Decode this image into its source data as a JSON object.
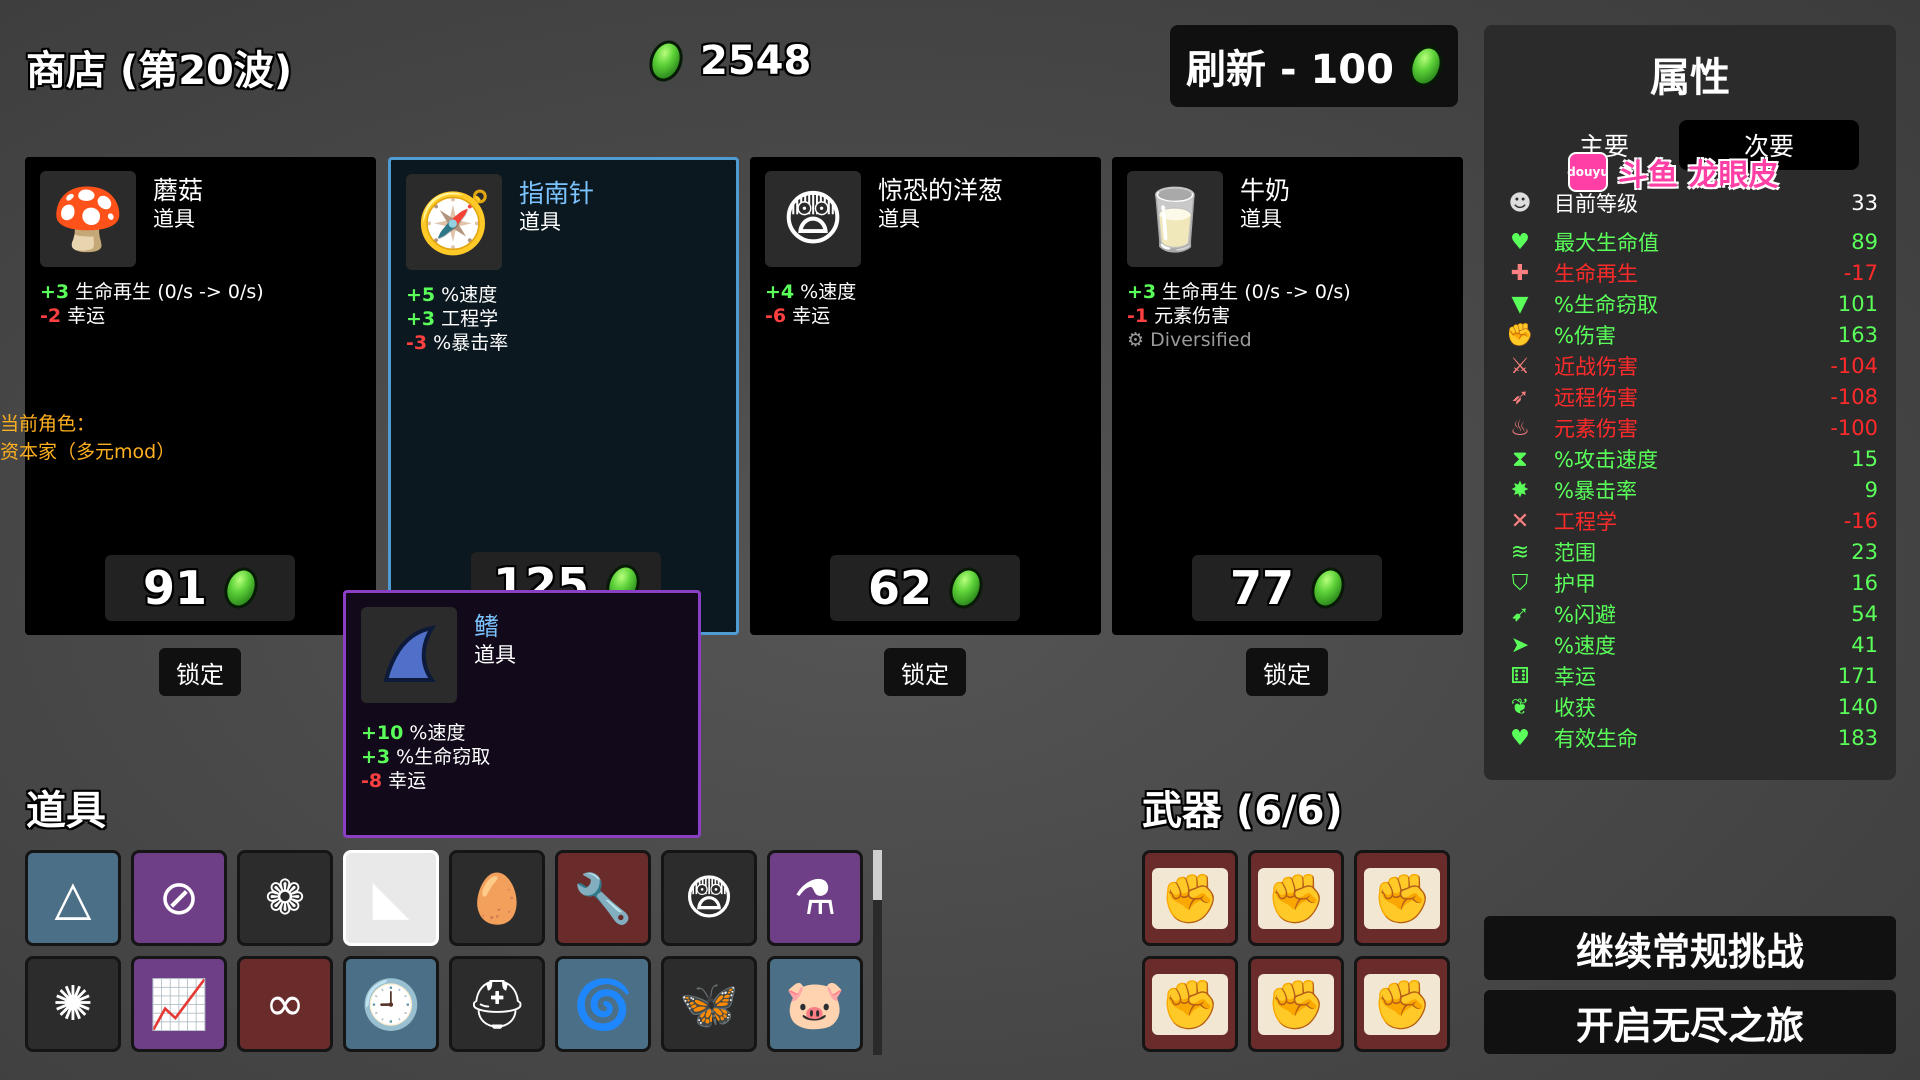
{
  "header": {
    "title": "商店 (第20波)",
    "materials": "2548",
    "refresh_label": "刷新 - 100"
  },
  "colors": {
    "positive": "#5aff5a",
    "negative": "#ff4040",
    "selected_border": "#4f9bd2",
    "tooltip_border": "#8a3fc4"
  },
  "shop": [
    {
      "name": "蘑菇",
      "type": "道具",
      "icon": "mushroom-icon",
      "price": "91",
      "lock": "锁定",
      "stats": [
        {
          "v": "+3",
          "s": "pos",
          "t": " 生命再生 (0/s -> 0/s)"
        },
        {
          "v": "-2",
          "s": "neg",
          "t": " 幸运"
        }
      ]
    },
    {
      "name": "指南针",
      "type": "道具",
      "icon": "compass-icon",
      "price": "125",
      "lock": "锁定",
      "stats": [
        {
          "v": "+5",
          "s": "pos",
          "t": " %速度"
        },
        {
          "v": "+3",
          "s": "pos",
          "t": " 工程学"
        },
        {
          "v": "-3",
          "s": "neg",
          "t": " %暴击率"
        }
      ]
    },
    {
      "name": "惊恐的洋葱",
      "type": "道具",
      "icon": "scared-onion-icon",
      "price": "62",
      "lock": "锁定",
      "stats": [
        {
          "v": "+4",
          "s": "pos",
          "t": " %速度"
        },
        {
          "v": "-6",
          "s": "neg",
          "t": " 幸运"
        }
      ]
    },
    {
      "name": "牛奶",
      "type": "道具",
      "icon": "milk-icon",
      "price": "77",
      "lock": "锁定",
      "stats": [
        {
          "v": "+3",
          "s": "pos",
          "t": " 生命再生 (0/s -> 0/s)"
        },
        {
          "v": "-1",
          "s": "neg",
          "t": " 元素伤害"
        }
      ],
      "extra": "Diversified"
    }
  ],
  "character": {
    "label": "当前角色：",
    "name": "资本家（多元mod）"
  },
  "tooltip": {
    "name": "鳍",
    "type": "道具",
    "icon": "fin-icon",
    "stats": [
      {
        "v": "+10",
        "s": "pos",
        "t": " %速度"
      },
      {
        "v": "+3",
        "s": "pos",
        "t": " %生命窃取"
      },
      {
        "v": "-8",
        "s": "neg",
        "t": " 幸运"
      }
    ]
  },
  "items_title": "道具",
  "items": [
    {
      "icon": "triangle-icon",
      "bg": "blue"
    },
    {
      "icon": "no-weapon-icon",
      "bg": "purple"
    },
    {
      "icon": "sponge-icon",
      "bg": "dark"
    },
    {
      "icon": "fin-icon",
      "bg": "white"
    },
    {
      "icon": "egg-monocle-icon",
      "bg": "dark"
    },
    {
      "icon": "wrench-icon",
      "bg": "red"
    },
    {
      "icon": "scared-onion-icon",
      "bg": "dark"
    },
    {
      "icon": "potion-bag-icon",
      "bg": "purple"
    },
    {
      "icon": "virus-icon",
      "bg": "dark"
    },
    {
      "icon": "chart-up-icon",
      "bg": "purple"
    },
    {
      "icon": "binoculars-icon",
      "bg": "red"
    },
    {
      "icon": "clock-icon",
      "bg": "blue"
    },
    {
      "icon": "helmet-icon",
      "bg": "dark"
    },
    {
      "icon": "scroll-roll-icon",
      "bg": "blue"
    },
    {
      "icon": "butterfly-icon",
      "bg": "dark"
    },
    {
      "icon": "piggy-bank-icon",
      "bg": "blue"
    }
  ],
  "weapons_title": "武器 (6/6)",
  "weapons": [
    {
      "icon": "contract-fist-icon"
    },
    {
      "icon": "contract-fist-icon"
    },
    {
      "icon": "contract-fist-icon"
    },
    {
      "icon": "contract-fist-icon"
    },
    {
      "icon": "contract-fist-icon"
    },
    {
      "icon": "contract-fist-icon"
    }
  ],
  "stats_panel": {
    "title": "属性",
    "tab_primary": "主要",
    "tab_secondary": "次要",
    "rows": [
      {
        "label": "目前等级",
        "value": "33",
        "c": "w",
        "icon": "level-icon",
        "glyph": "☻"
      },
      {
        "label": "最大生命值",
        "value": "89",
        "c": "g",
        "icon": "heart-icon",
        "glyph": "♥"
      },
      {
        "label": "生命再生",
        "value": "-17",
        "c": "r",
        "icon": "heart-plus-icon",
        "glyph": "✚"
      },
      {
        "label": "%生命窃取",
        "value": "101",
        "c": "g",
        "icon": "fangs-icon",
        "glyph": "▼"
      },
      {
        "label": "%伤害",
        "value": "163",
        "c": "g",
        "icon": "muscle-icon",
        "glyph": "✊"
      },
      {
        "label": "近战伤害",
        "value": "-104",
        "c": "r",
        "icon": "sword-icon",
        "glyph": "⚔"
      },
      {
        "label": "远程伤害",
        "value": "-108",
        "c": "r",
        "icon": "bow-icon",
        "glyph": "➶"
      },
      {
        "label": "元素伤害",
        "value": "-100",
        "c": "r",
        "icon": "flame-icon",
        "glyph": "♨"
      },
      {
        "label": "%攻击速度",
        "value": "15",
        "c": "g",
        "icon": "hourglass-icon",
        "glyph": "⧗"
      },
      {
        "label": "%暴击率",
        "value": "9",
        "c": "g",
        "icon": "crit-icon",
        "glyph": "✸"
      },
      {
        "label": "工程学",
        "value": "-16",
        "c": "r",
        "icon": "wrench-cross-icon",
        "glyph": "✕"
      },
      {
        "label": "范围",
        "value": "23",
        "c": "g",
        "icon": "range-icon",
        "glyph": "≋"
      },
      {
        "label": "护甲",
        "value": "16",
        "c": "g",
        "icon": "shield-icon",
        "glyph": "⛉"
      },
      {
        "label": "%闪避",
        "value": "54",
        "c": "g",
        "icon": "dodge-icon",
        "glyph": "➹"
      },
      {
        "label": "%速度",
        "value": "41",
        "c": "g",
        "icon": "boot-icon",
        "glyph": "➤"
      },
      {
        "label": "幸运",
        "value": "171",
        "c": "g",
        "icon": "dice-icon",
        "glyph": "⚅"
      },
      {
        "label": "收获",
        "value": "140",
        "c": "g",
        "icon": "wheat-icon",
        "glyph": "❦"
      },
      {
        "label": "有效生命",
        "value": "183",
        "c": "g",
        "icon": "shield-heart-icon",
        "glyph": "♥"
      }
    ]
  },
  "buttons": {
    "continue": "继续常规挑战",
    "endless": "开启无尽之旅"
  },
  "watermark": {
    "logo_text": "douyu",
    "text": "斗鱼 龙眼皮"
  }
}
